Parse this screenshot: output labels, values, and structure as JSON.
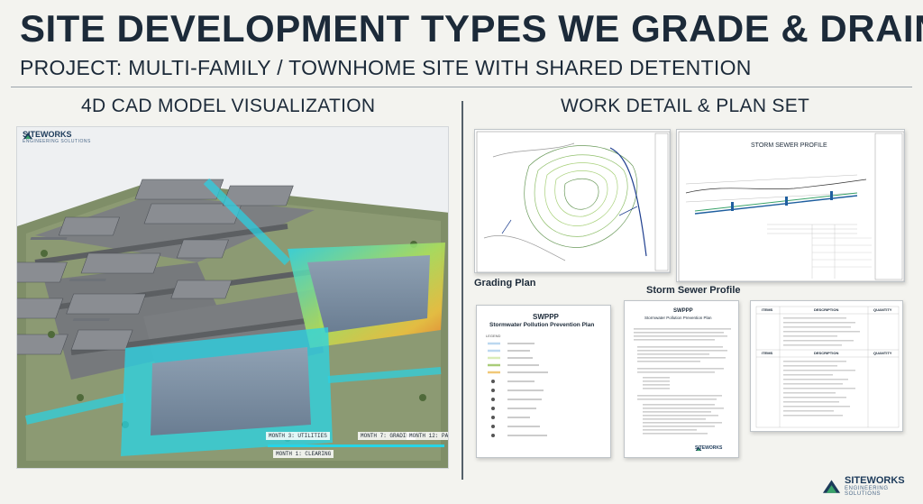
{
  "header": {
    "title": "SITE DEVELOPMENT TYPES WE GRADE & DRAIN",
    "subtitle": "PROJECT: MULTI-FAMILY / TOWNHOME SITE WITH SHARED DETENTION"
  },
  "left_panel": {
    "heading": "4D CAD MODEL VISUALIZATION",
    "logo_title": "SITEWORKS",
    "logo_sub": "ENGINEERING SOLUTIONS",
    "timeline": {
      "step1": "MONTH 1: CLEARING",
      "step2": "MONTH 3: UTILITIES",
      "step3": "MONTH 7: GRADING",
      "step4": "MONTH 12: PAVING"
    }
  },
  "right_panel": {
    "heading": "WORK DETAIL & PLAN SET",
    "grading_caption": "Grading Plan",
    "storm_caption": "Storm Sewer Profile",
    "storm_title": "STORM SEWER PROFILE",
    "swppp1_title": "SWPPP",
    "swppp1_sub": "Stormwater Pollution Prevention Plan",
    "swppp1_legend": "LEGEND",
    "swppp2_title": "SWPPP",
    "swppp2_sub": "Stormwater Pollution Prevention Plan",
    "schedule_head_item": "ITEMS",
    "schedule_head_desc": "DESCRIPTION",
    "schedule_head_qty": "QUANTITY",
    "schedule_head_item2": "ITEMS",
    "schedule_head_desc2": "DESCRIPTION",
    "schedule_head_qty2": "QUANTITY",
    "doc_logo": "SITEWORKS"
  },
  "footer": {
    "logo_title": "SITEWORKS",
    "logo_sub": "ENGINEERING SOLUTIONS"
  },
  "colors": {
    "navy": "#1c2a39",
    "brand_blue": "#1c3a5a",
    "brand_green": "#3aa36a",
    "detention_cyan": "#28d4e6",
    "grass": "#7f8e68"
  }
}
